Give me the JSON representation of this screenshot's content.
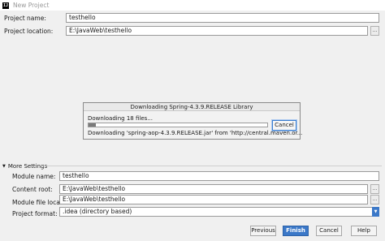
{
  "window": {
    "title": "New Project",
    "app_icon_text": "IJ"
  },
  "top": {
    "project_name_label": "Project name:",
    "project_name_value": "testhello",
    "project_location_label": "Project location:",
    "project_location_value": "E:\\JavaWeb\\testhello",
    "browse_label": "..."
  },
  "download_dialog": {
    "title": "Downloading Spring-4.3.9.RELEASE Library",
    "status": "Downloading 18 files...",
    "detail": "Downloading 'spring-aop-4.3.9.RELEASE.jar' from 'http://central.maven.or...",
    "progress_fraction": 0.04,
    "cancel_label": "Cancel"
  },
  "more_settings": {
    "header": "More Settings",
    "module_name_label": "Module name:",
    "module_name_value": "testhello",
    "content_root_label": "Content root:",
    "content_root_value": "E:\\JavaWeb\\testhello",
    "module_file_location_label": "Module file location:",
    "module_file_location_value": "E:\\JavaWeb\\testhello",
    "project_format_label": "Project format:",
    "project_format_value": ".idea (directory based)"
  },
  "buttons": {
    "previous": "Previous",
    "finish": "Finish",
    "cancel": "Cancel",
    "help": "Help"
  },
  "colors": {
    "accent": "#3b78c8",
    "background": "#f0f0f0"
  }
}
